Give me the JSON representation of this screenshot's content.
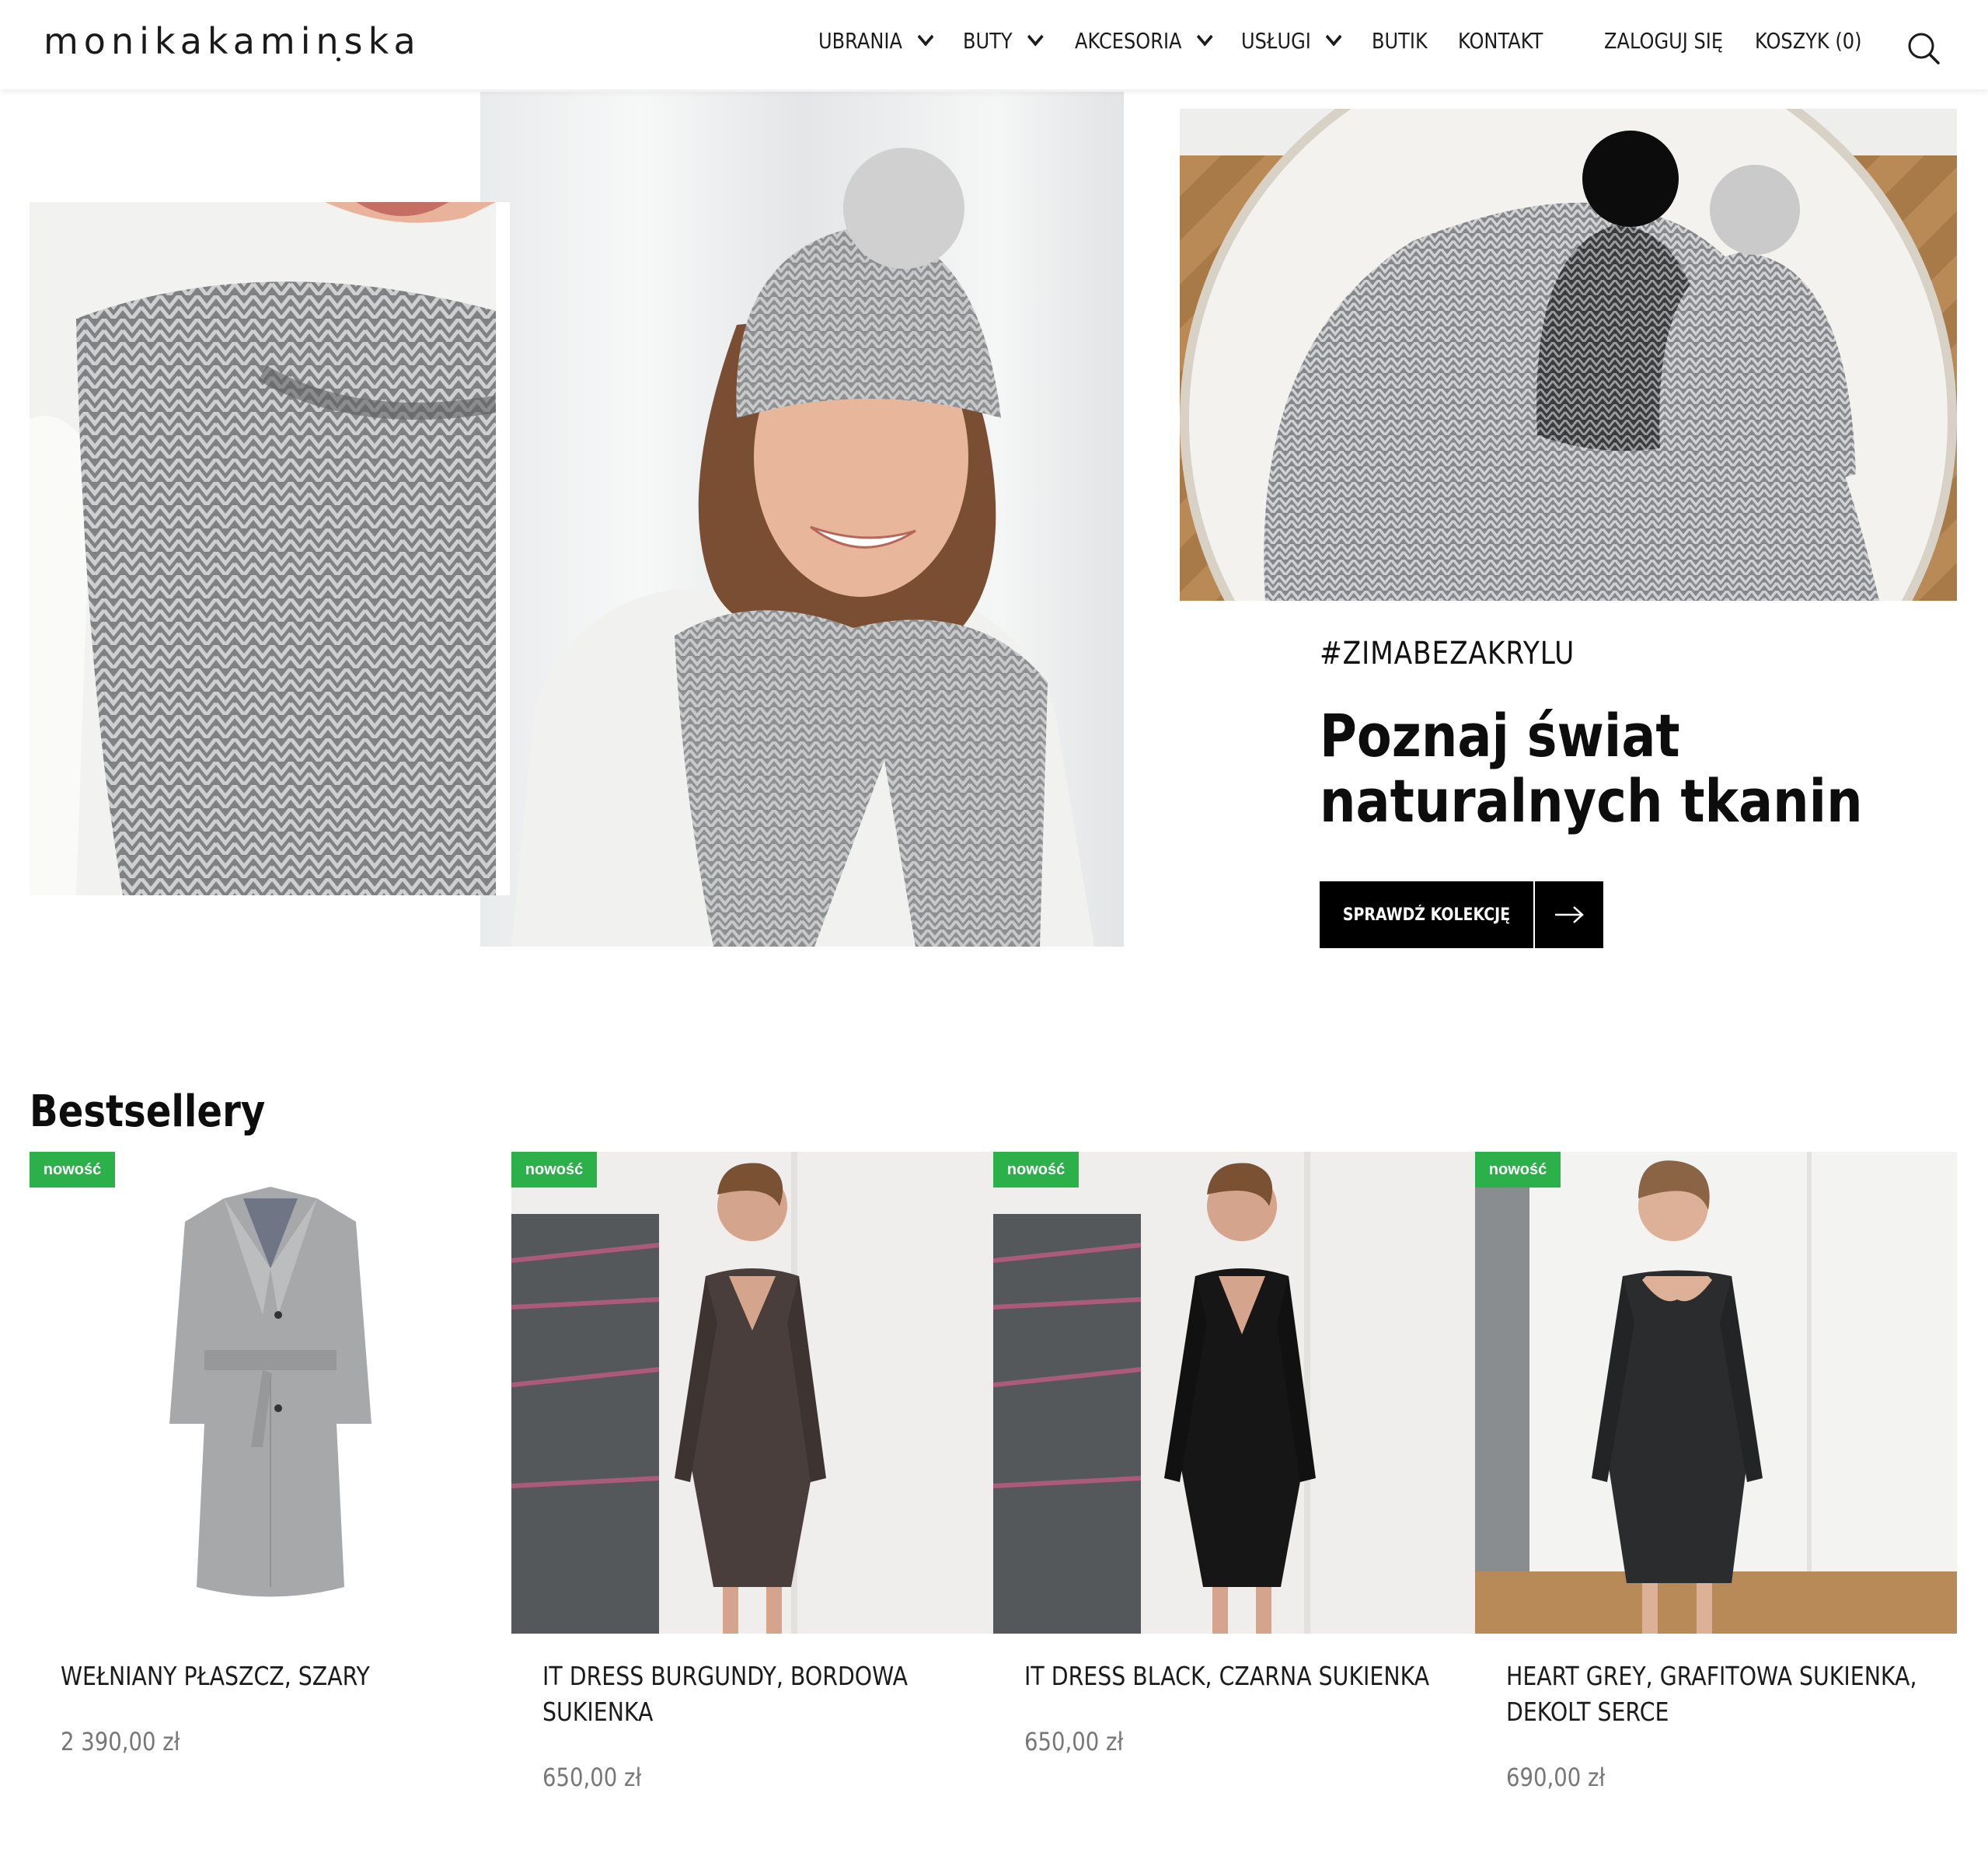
{
  "brand": {
    "logo": "monikakaminska"
  },
  "nav": {
    "items": [
      {
        "label": "UBRANIA",
        "dropdown": true
      },
      {
        "label": "BUTY",
        "dropdown": true
      },
      {
        "label": "AKCESORIA",
        "dropdown": true
      },
      {
        "label": "USŁUGI",
        "dropdown": true
      },
      {
        "label": "BUTIK",
        "dropdown": false
      },
      {
        "label": "KONTAKT",
        "dropdown": false
      }
    ],
    "login": "ZALOGUJ SIĘ",
    "cart": "KOSZYK (0)",
    "search_icon": "search-icon"
  },
  "hero": {
    "hashtag": "#ZIMABEZAKRYLU",
    "headline_line1": "Poznaj świat",
    "headline_line2": "naturalnych tkanin",
    "cta_label": "SPRAWDŹ KOLEKCJĘ",
    "cta_icon": "arrow-right-icon"
  },
  "bestsellers": {
    "title": "Bestsellery",
    "products": [
      {
        "badge": "nowość",
        "name": "WEŁNIANY PŁASZCZ, SZARY",
        "price": "2 390,00 zł"
      },
      {
        "badge": "nowość",
        "name": "IT DRESS BURGUNDY, BORDOWA SUKIENKA",
        "price": "650,00 zł"
      },
      {
        "badge": "nowość",
        "name": "IT DRESS BLACK, CZARNA SUKIENKA",
        "price": "650,00 zł"
      },
      {
        "badge": "nowość",
        "name": "HEART GREY, GRAFITOWA SUKIENKA, DEKOLT SERCE",
        "price": "690,00 zł"
      }
    ]
  },
  "colors": {
    "badge": "#2bb04a",
    "cta": "#000000",
    "price": "#777777",
    "text": "#111111"
  }
}
